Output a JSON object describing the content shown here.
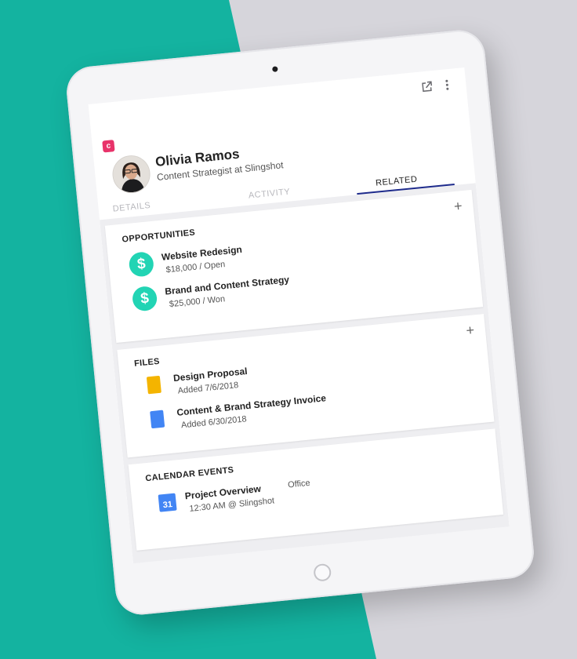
{
  "app": {
    "logo_letter": "c"
  },
  "toolbar": {
    "open_external_icon": "open-external-icon",
    "more_icon": "more-vert-icon"
  },
  "contact": {
    "name": "Olivia Ramos",
    "title": "Content Strategist at Slingshot"
  },
  "tabs": [
    {
      "label": "DETAILS",
      "active": false
    },
    {
      "label": "ACTIVITY",
      "active": false
    },
    {
      "label": "RELATED",
      "active": true
    }
  ],
  "opportunities": {
    "title": "OPPORTUNITIES",
    "items": [
      {
        "name": "Website Redesign",
        "detail": "$18,000 / Open"
      },
      {
        "name": "Brand and Content Strategy",
        "detail": "$25,000 / Won"
      }
    ]
  },
  "files": {
    "title": "FILES",
    "items": [
      {
        "name": "Design Proposal",
        "detail": "Added 7/6/2018",
        "icon": "slides-file-icon"
      },
      {
        "name": "Content & Brand Strategy Invoice",
        "detail": "Added 6/30/2018",
        "icon": "docs-file-icon"
      }
    ]
  },
  "calendar": {
    "title": "CALENDAR EVENTS",
    "items": [
      {
        "name": "Project Overview",
        "detail": "12:30 AM @ Slingshot",
        "location": "Office",
        "day": "31"
      }
    ]
  },
  "colors": {
    "teal_background": "#14b3a0",
    "accent_pink": "#e8336a",
    "money_green": "#22d4b4",
    "tab_underline": "#1e2b8c"
  }
}
